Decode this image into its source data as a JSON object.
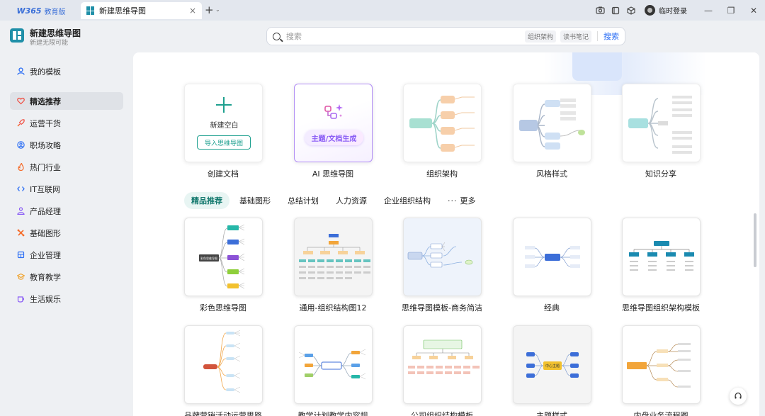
{
  "titlebar": {
    "brand": "W365",
    "brand_edition": "教育版",
    "active_tab": "新建思维导图",
    "close_glyph": "×",
    "add_glyph": "+",
    "caret_glyph": "⌄",
    "login": "临时登录",
    "icons": [
      "screenshot-icon",
      "window-icon",
      "cube-icon",
      "avatar"
    ]
  },
  "app": {
    "title": "新建思维导图",
    "subtitle": "新建无限可能"
  },
  "search": {
    "placeholder": "搜索",
    "chips": [
      "组织架构",
      "读书笔记"
    ],
    "button": "搜索"
  },
  "sidebar": {
    "items": [
      {
        "label": "我的模板",
        "icon": "person-icon",
        "color": "#2a6df4",
        "active": false
      },
      {
        "label": "精选推荐",
        "icon": "heart-icon",
        "color": "#f04b3e",
        "active": true
      },
      {
        "label": "运营干货",
        "icon": "rocket-icon",
        "color": "#f04b3e",
        "active": false
      },
      {
        "label": "职场攻略",
        "icon": "user-circle-icon",
        "color": "#2a6df4",
        "active": false
      },
      {
        "label": "热门行业",
        "icon": "flame-icon",
        "color": "#f56c2a",
        "active": false
      },
      {
        "label": "IT互联网",
        "icon": "code-icon",
        "color": "#2a6df4",
        "active": false
      },
      {
        "label": "产品经理",
        "icon": "people-icon",
        "color": "#8a5cf5",
        "active": false
      },
      {
        "label": "基础图形",
        "icon": "cross-icon",
        "color": "#f56c2a",
        "active": false
      },
      {
        "label": "企业管理",
        "icon": "building-icon",
        "color": "#2a6df4",
        "active": false
      },
      {
        "label": "教育教学",
        "icon": "graduation-cap-icon",
        "color": "#f0a12a",
        "active": false
      },
      {
        "label": "生活娱乐",
        "icon": "cup-icon",
        "color": "#8a5cf5",
        "active": false
      }
    ]
  },
  "quick_cards": [
    {
      "label": "创建文档",
      "new_label": "新建空白",
      "import_label": "导入思维导图"
    },
    {
      "label": "AI 思维导图",
      "ai_button": "主题/文档生成"
    },
    {
      "label": "组织架构"
    },
    {
      "label": "风格样式"
    },
    {
      "label": "知识分享"
    }
  ],
  "categories": [
    "精品推荐",
    "基础图形",
    "总结计划",
    "人力资源",
    "企业组织结构",
    "更多"
  ],
  "more_glyph": "···",
  "templates": [
    {
      "label": "彩色思维导图"
    },
    {
      "label": "通用-组织结构图12"
    },
    {
      "label": "思维导图模板-商务简洁"
    },
    {
      "label": "经典"
    },
    {
      "label": "思维导图组织架构模板"
    },
    {
      "label": "品牌营销活动运营思路"
    },
    {
      "label": "教学计划教学内容规"
    },
    {
      "label": "公司组织结构模板"
    },
    {
      "label": "主题样式"
    },
    {
      "label": "内盘业务流程图"
    }
  ],
  "thumb_text": {
    "center_topic": "中心主题",
    "color_center": "彩色思维导图"
  },
  "colors": {
    "accent": "#1ea08f",
    "link": "#2a6df4",
    "ai": "#8a5cf5"
  }
}
